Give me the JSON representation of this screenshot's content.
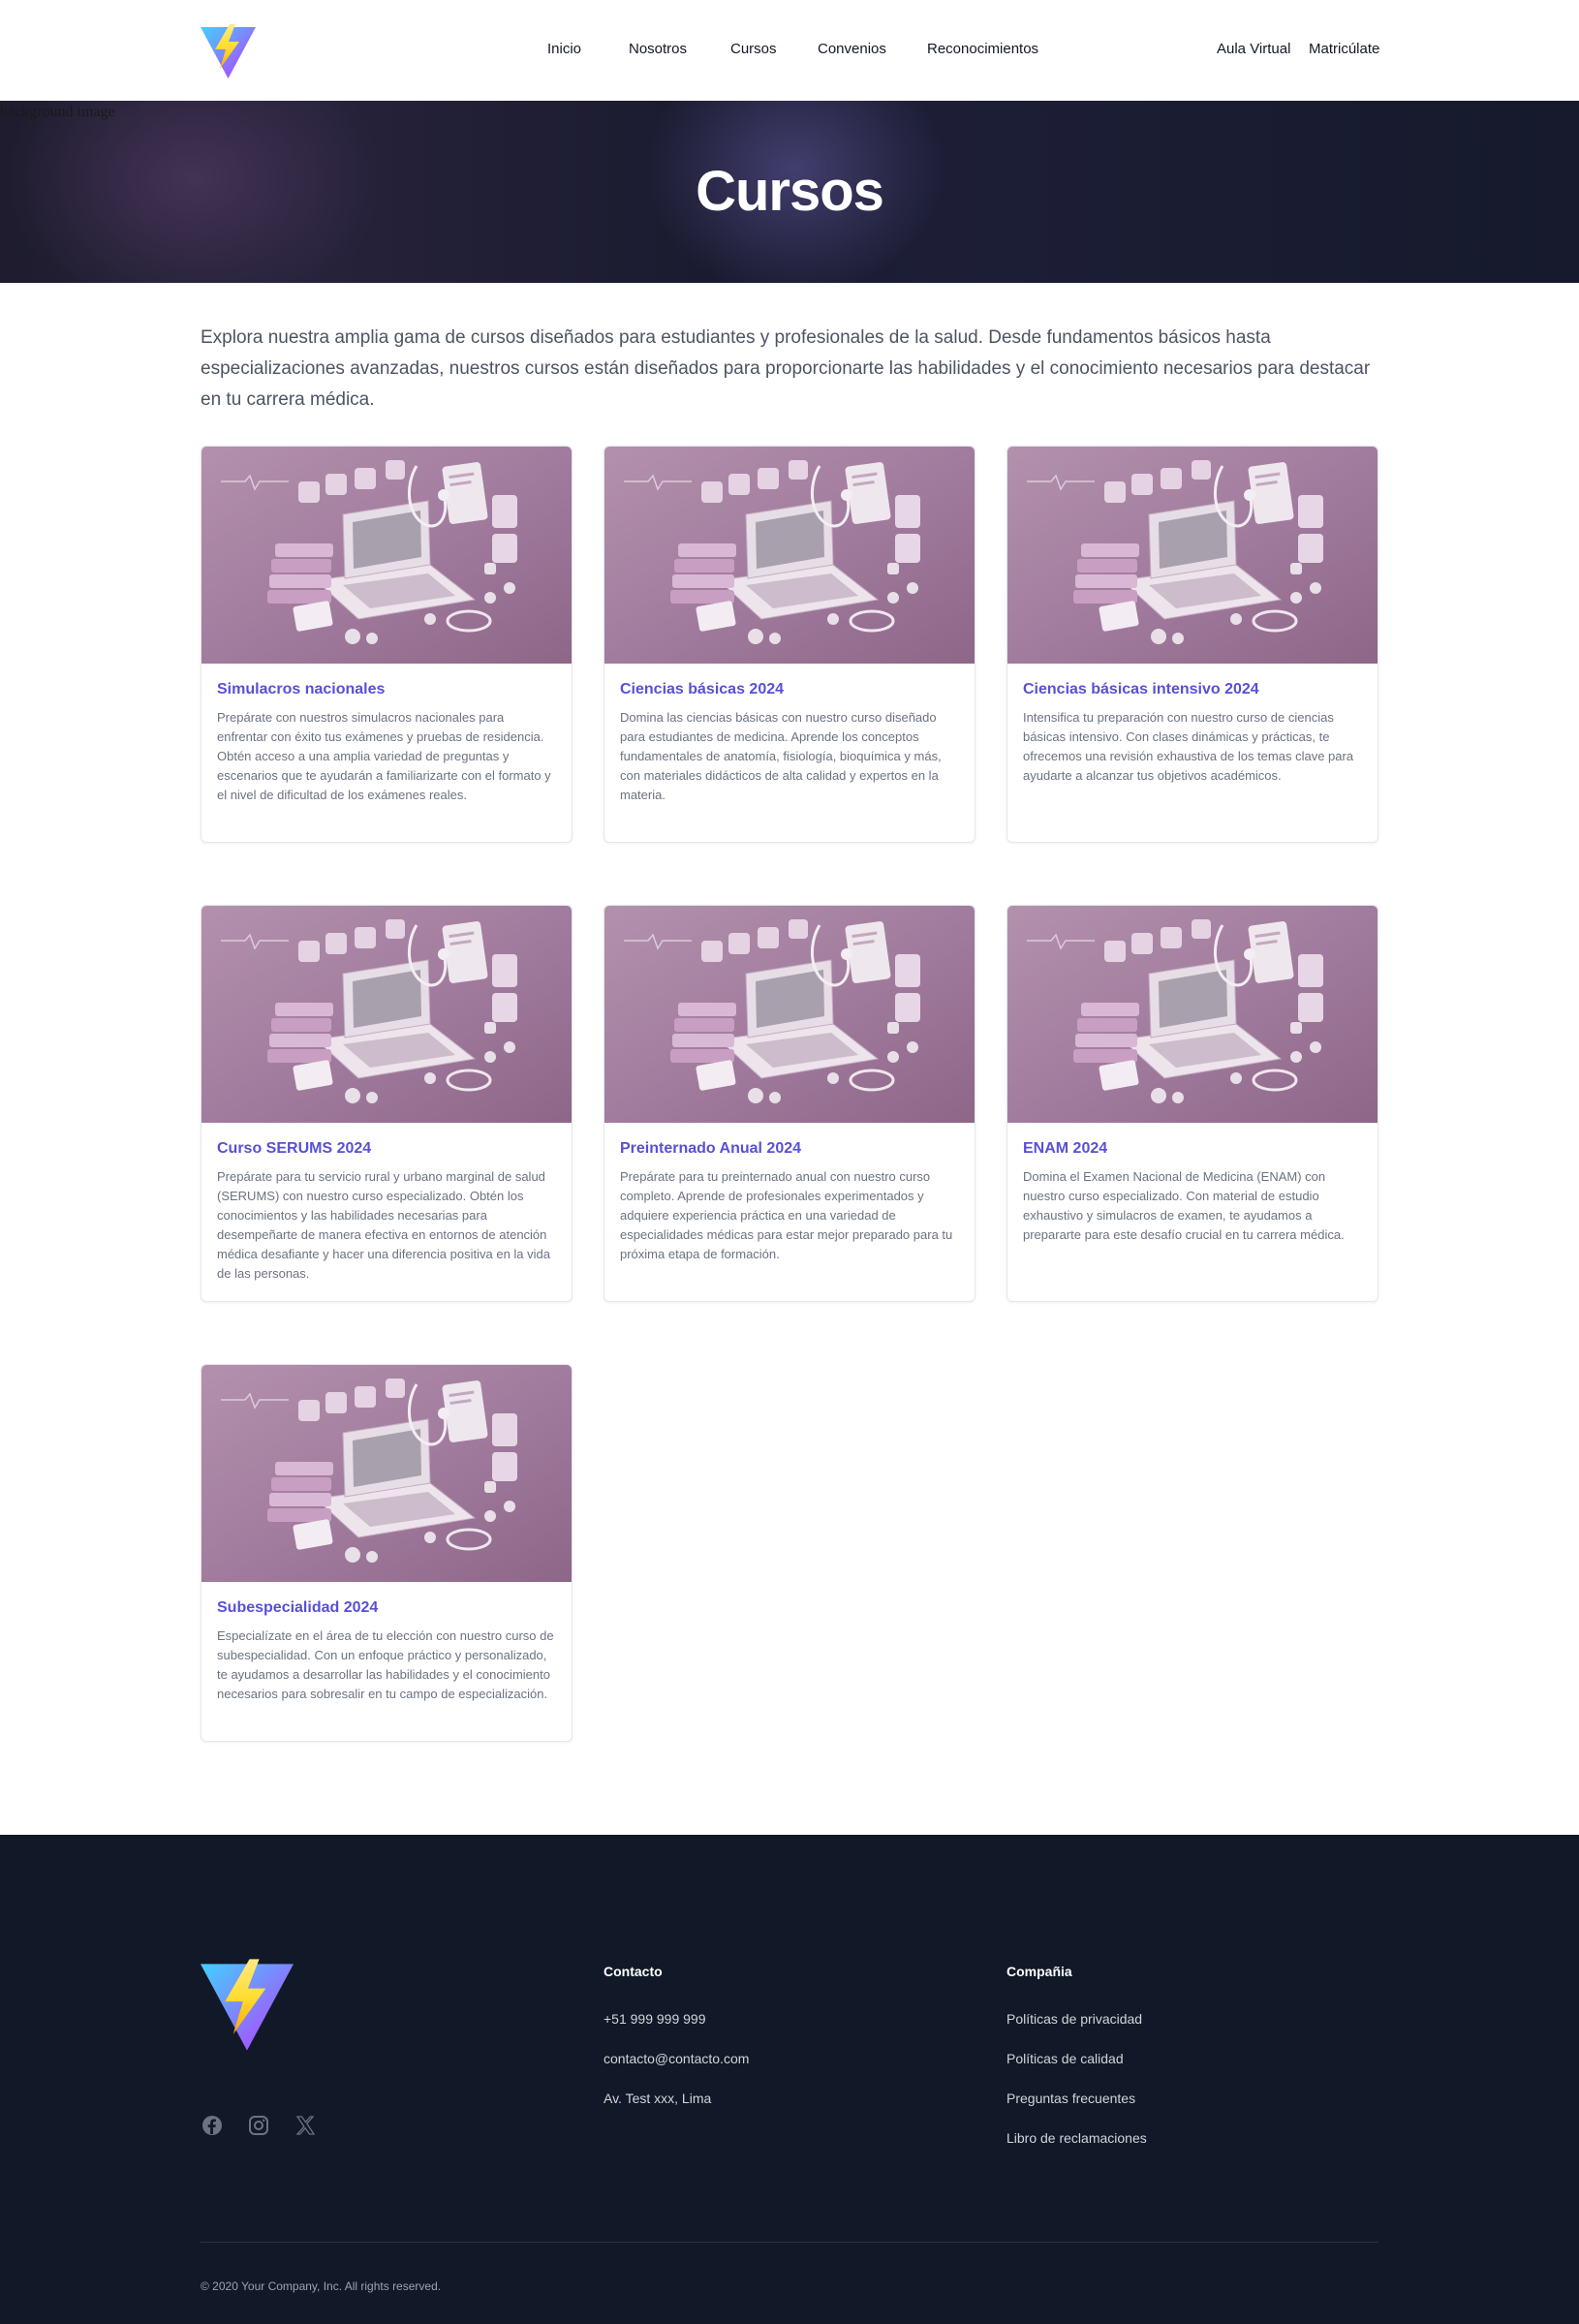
{
  "nav": {
    "links": [
      {
        "label": "Inicio"
      },
      {
        "label": "Nosotros"
      },
      {
        "label": "Cursos"
      },
      {
        "label": "Convenios"
      },
      {
        "label": "Reconocimientos"
      }
    ],
    "aula_label": "Aula Virtual",
    "enroll_label": "Matricúlate"
  },
  "hero": {
    "image_alt": "background image",
    "title": "Cursos"
  },
  "intro": "Explora nuestra amplia gama de cursos diseñados para estudiantes y profesionales de la salud. Desde fundamentos básicos hasta especializaciones avanzadas, nuestros cursos están diseñados para proporcionarte las habilidades y el conocimiento necesarios para destacar en tu carrera médica.",
  "courses": [
    {
      "title": "Simulacros nacionales",
      "description": "Prepárate con nuestros simulacros nacionales para enfrentar con éxito tus exámenes y pruebas de residencia. Obtén acceso a una amplia variedad de preguntas y escenarios que te ayudarán a familiarizarte con el formato y el nivel de dificultad de los exámenes reales."
    },
    {
      "title": "Ciencias básicas 2024",
      "description": "Domina las ciencias básicas con nuestro curso diseñado para estudiantes de medicina. Aprende los conceptos fundamentales de anatomía, fisiología, bioquímica y más, con materiales didácticos de alta calidad y expertos en la materia."
    },
    {
      "title": "Ciencias básicas intensivo 2024",
      "description": "Intensifica tu preparación con nuestro curso de ciencias básicas intensivo. Con clases dinámicas y prácticas, te ofrecemos una revisión exhaustiva de los temas clave para ayudarte a alcanzar tus objetivos académicos."
    },
    {
      "title": "Curso SERUMS 2024",
      "description": "Prepárate para tu servicio rural y urbano marginal de salud (SERUMS) con nuestro curso especializado. Obtén los conocimientos y las habilidades necesarias para desempeñarte de manera efectiva en entornos de atención médica desafiante y hacer una diferencia positiva en la vida de las personas."
    },
    {
      "title": "Preinternado Anual 2024",
      "description": "Prepárate para tu preinternado anual con nuestro curso completo. Aprende de profesionales experimentados y adquiere experiencia práctica en una variedad de especialidades médicas para estar mejor preparado para tu próxima etapa de formación."
    },
    {
      "title": "ENAM 2024",
      "description": "Domina el Examen Nacional de Medicina (ENAM) con nuestro curso especializado. Con material de estudio exhaustivo y simulacros de examen, te ayudamos a prepararte para este desafío crucial en tu carrera médica."
    },
    {
      "title": "Subespecialidad 2024",
      "description": "Especialízate en el área de tu elección con nuestro curso de subespecialidad. Con un enfoque práctico y personalizado, te ayudamos a desarrollar las habilidades y el conocimiento necesarios para sobresalir en tu campo de especialización."
    }
  ],
  "footer": {
    "social_icons": [
      "facebook-icon",
      "instagram-icon",
      "x-icon"
    ],
    "contact": {
      "heading": "Contacto",
      "phone": "+51 999 999 999",
      "email": "contacto@contacto.com",
      "address": "Av. Test xxx, Lima"
    },
    "company": {
      "heading": "Compañia",
      "links": [
        "Políticas de privacidad",
        "Políticas de calidad",
        "Preguntas frecuentes",
        "Libro de reclamaciones"
      ]
    },
    "copyright": "© 2020 Your Company, Inc. All rights reserved."
  },
  "colors": {
    "accent": "#5850d6",
    "footer_bg": "#111827",
    "hero_bg": "#1b1c30",
    "card_image_bg": "#a07b9c"
  }
}
